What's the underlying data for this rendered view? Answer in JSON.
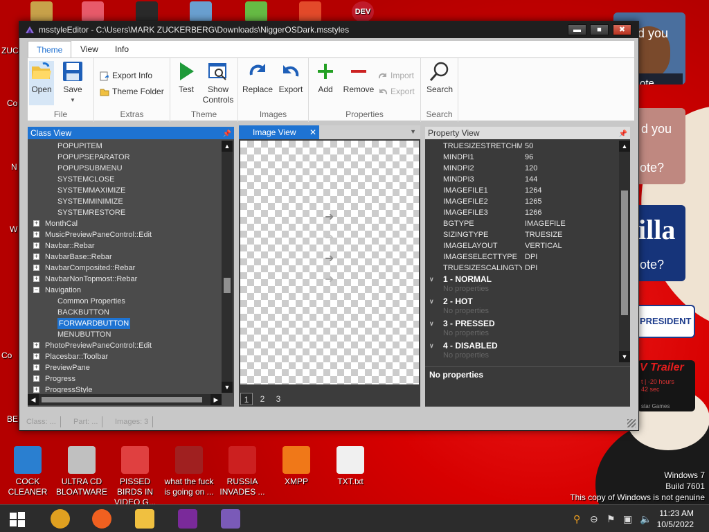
{
  "desktop": {
    "top_icons": [
      {
        "name": "top-icon-1",
        "color": "#c8a24a",
        "label": ""
      },
      {
        "name": "top-icon-2",
        "color": "#e85a6a",
        "label": ""
      },
      {
        "name": "top-icon-3",
        "color": "#2a2a2a",
        "label": ""
      },
      {
        "name": "top-icon-4",
        "color": "#6aa0d0",
        "label": ""
      },
      {
        "name": "top-icon-5",
        "color": "#66bb44",
        "label": ""
      },
      {
        "name": "top-icon-6",
        "color": "#e34a2a",
        "label": ""
      },
      {
        "name": "top-icon-7",
        "color": "#c01a2a",
        "label": "DEV"
      }
    ],
    "left_edge_labels": [
      "ZUC",
      "Co",
      "N",
      "W",
      "Co",
      "BE"
    ],
    "bottom_icons": [
      {
        "label": "COCK CLEANER",
        "color": "#2a7fd0"
      },
      {
        "label": "ULTRA CD BLOATWARE",
        "color": "#c0c0c0"
      },
      {
        "label": "PISSED BIRDS IN VIDEO G...",
        "color": "#e04040"
      },
      {
        "label": "what the fuck is going on ...",
        "color": "#a02020"
      },
      {
        "label": "RUSSIA INVADES ...",
        "color": "#cc2020"
      },
      {
        "label": "XMPP",
        "color": "#f07818"
      },
      {
        "label": "TXT.txt",
        "color": "#f0f0f0"
      }
    ],
    "side_cards": {
      "card1_text": "d you",
      "card1_text2": "ote.",
      "card2_text": "d you",
      "card2_text2": "ote?",
      "card3_text": "illa",
      "card3_text2": "ote?",
      "card4_text": "PRESIDENT",
      "card5_text": "V Trailer",
      "card5_text2": "t | -20 hours\n42 sec",
      "card5_text3": "star Games"
    },
    "watermark": {
      "line1": "Windows 7",
      "line2": "Build 7601",
      "line3": "This copy of Windows is not genuine"
    }
  },
  "window": {
    "title": "msstyleEditor - C:\\Users\\MARK ZUCKERBERG\\Downloads\\NiggerOSDark.msstyles",
    "controls": {
      "minimize": "▬",
      "maximize": "■",
      "close": "✖"
    },
    "menu_tabs": [
      "Theme",
      "View",
      "Info"
    ],
    "ribbon": {
      "groups": [
        {
          "label": "File"
        },
        {
          "label": "Extras"
        },
        {
          "label": "Theme"
        },
        {
          "label": "Images"
        },
        {
          "label": "Properties"
        },
        {
          "label": "Search"
        }
      ],
      "buttons": {
        "open": "Open",
        "save": "Save",
        "export_info": "Export Info",
        "theme_folder": "Theme Folder",
        "test": "Test",
        "show_controls": "Show Controls",
        "replace": "Replace",
        "export": "Export",
        "add": "Add",
        "remove": "Remove",
        "import": "Import",
        "export_small": "Export",
        "search": "Search"
      }
    },
    "class_view": {
      "title": "Class View",
      "rows": [
        {
          "label": "POPUPITEM",
          "indent": 2,
          "expander": ""
        },
        {
          "label": "POPUPSEPARATOR",
          "indent": 2,
          "expander": ""
        },
        {
          "label": "POPUPSUBMENU",
          "indent": 2,
          "expander": ""
        },
        {
          "label": "SYSTEMCLOSE",
          "indent": 2,
          "expander": ""
        },
        {
          "label": "SYSTEMMAXIMIZE",
          "indent": 2,
          "expander": ""
        },
        {
          "label": "SYSTEMMINIMIZE",
          "indent": 2,
          "expander": ""
        },
        {
          "label": "SYSTEMRESTORE",
          "indent": 2,
          "expander": ""
        },
        {
          "label": "MonthCal",
          "indent": 1,
          "expander": "+"
        },
        {
          "label": "MusicPreviewPaneControl::Edit",
          "indent": 1,
          "expander": "+"
        },
        {
          "label": "Navbar::Rebar",
          "indent": 1,
          "expander": "+"
        },
        {
          "label": "NavbarBase::Rebar",
          "indent": 1,
          "expander": "+"
        },
        {
          "label": "NavbarComposited::Rebar",
          "indent": 1,
          "expander": "+"
        },
        {
          "label": "NavbarNonTopmost::Rebar",
          "indent": 1,
          "expander": "+"
        },
        {
          "label": "Navigation",
          "indent": 1,
          "expander": "−"
        },
        {
          "label": "Common Properties",
          "indent": 2,
          "expander": ""
        },
        {
          "label": "BACKBUTTON",
          "indent": 2,
          "expander": ""
        },
        {
          "label": "FORWARDBUTTON",
          "indent": 2,
          "expander": "",
          "selected": true
        },
        {
          "label": "MENUBUTTON",
          "indent": 2,
          "expander": ""
        },
        {
          "label": "PhotoPreviewPaneControl::Edit",
          "indent": 1,
          "expander": "+"
        },
        {
          "label": "Placesbar::Toolbar",
          "indent": 1,
          "expander": "+"
        },
        {
          "label": "PreviewPane",
          "indent": 1,
          "expander": "+"
        },
        {
          "label": "Progress",
          "indent": 1,
          "expander": "+"
        },
        {
          "label": "ProgressStyle",
          "indent": 1,
          "expander": "+"
        }
      ]
    },
    "image_view": {
      "title": "Image View",
      "close": "✕",
      "pages": [
        "1",
        "2",
        "3"
      ],
      "active_page": 0
    },
    "property_view": {
      "title": "Property View",
      "props": [
        {
          "k": "TRUESIZESTRETCHM",
          "v": "50"
        },
        {
          "k": "MINDPI1",
          "v": "96"
        },
        {
          "k": "MINDPI2",
          "v": "120"
        },
        {
          "k": "MINDPI3",
          "v": "144"
        },
        {
          "k": "IMAGEFILE1",
          "v": "1264"
        },
        {
          "k": "IMAGEFILE2",
          "v": "1265"
        },
        {
          "k": "IMAGEFILE3",
          "v": "1266"
        },
        {
          "k": "BGTYPE",
          "v": "IMAGEFILE"
        },
        {
          "k": "SIZINGTYPE",
          "v": "TRUESIZE"
        },
        {
          "k": "IMAGELAYOUT",
          "v": "VERTICAL"
        },
        {
          "k": "IMAGESELECTTYPE",
          "v": "DPI"
        },
        {
          "k": "TRUESIZESCALINGTY",
          "v": "DPI"
        }
      ],
      "states": [
        {
          "label": "1 - NORMAL",
          "empty": "No properties"
        },
        {
          "label": "2 - HOT",
          "empty": "No properties"
        },
        {
          "label": "3 - PRESSED",
          "empty": "No properties"
        },
        {
          "label": "4 - DISABLED",
          "empty": "No properties"
        }
      ],
      "description": "No properties"
    },
    "status": [
      "Class: ...",
      "Part: ...",
      "Images: 3"
    ]
  },
  "taskbar": {
    "time": "11:23 AM",
    "date": "10/5/2022",
    "pinned": [
      {
        "name": "chrome-taskbar-icon",
        "color": "#e0a020"
      },
      {
        "name": "firefox-taskbar-icon",
        "color": "#f06020"
      },
      {
        "name": "explorer-taskbar-icon",
        "color": "#f0c040"
      },
      {
        "name": "yahoo-taskbar-icon",
        "color": "#7a2a9a"
      },
      {
        "name": "msstyleeditor-taskbar-icon",
        "color": "#7a5ab8"
      }
    ]
  },
  "colors": {
    "accent": "#1e73d2",
    "desktop_red": "#d40000",
    "add_green": "#24a024",
    "remove_red": "#cc2222"
  }
}
